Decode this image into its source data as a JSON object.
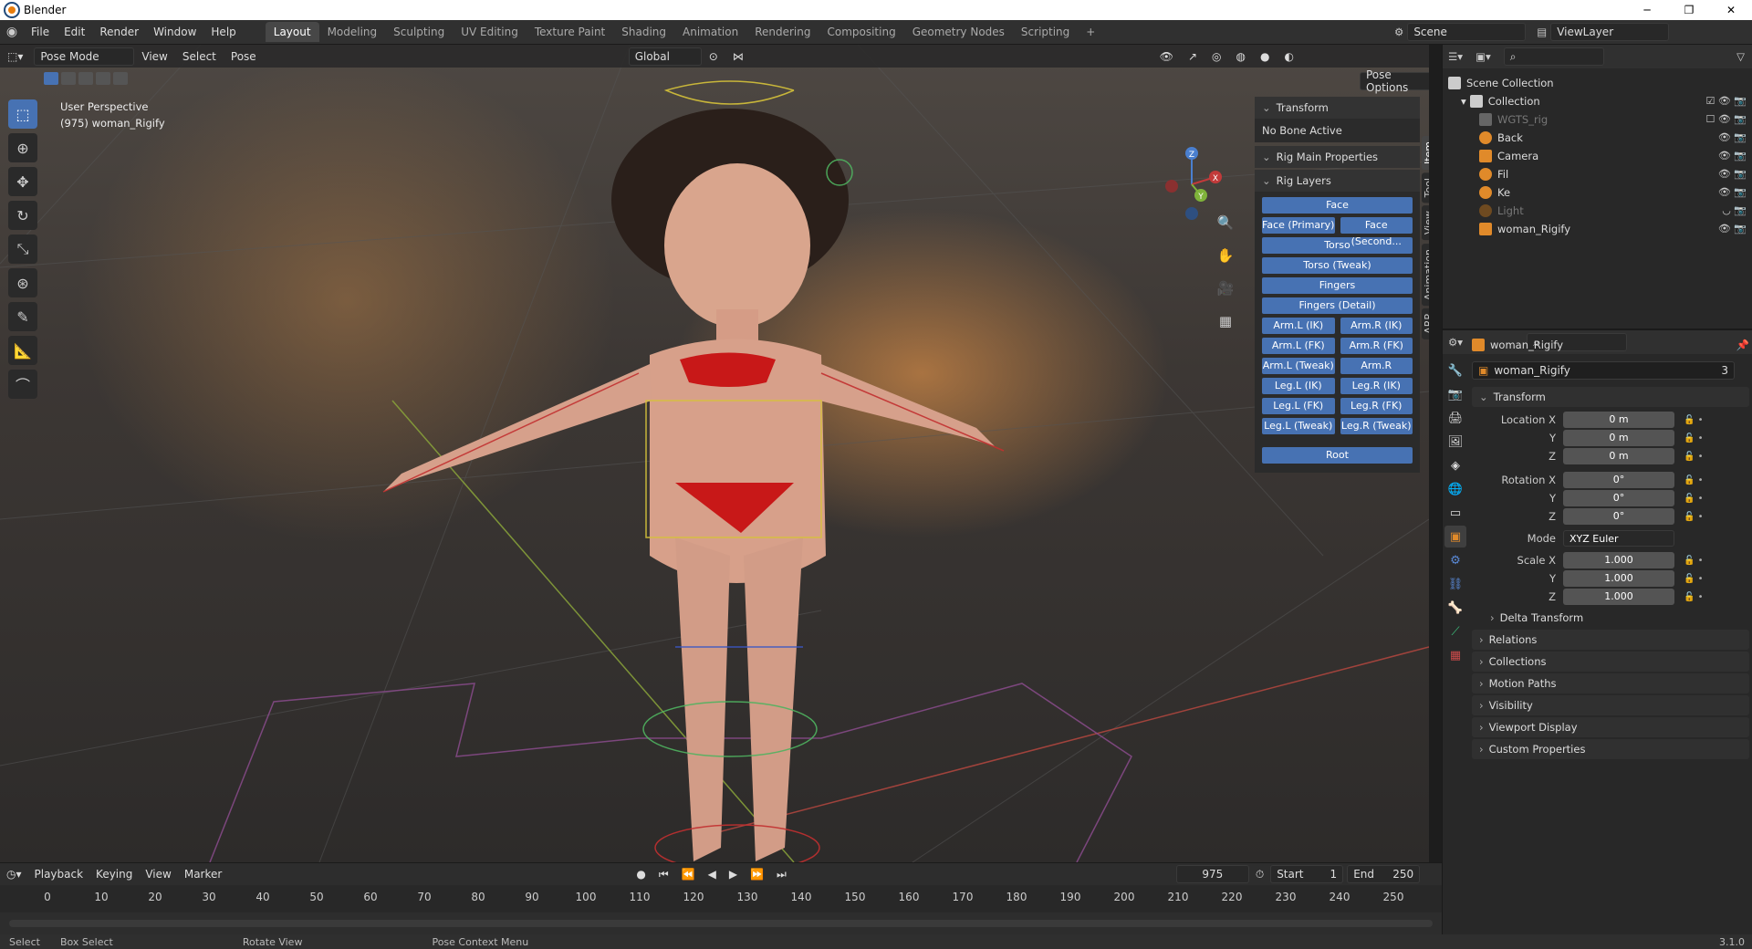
{
  "window": {
    "title": "Blender",
    "minimize": "─",
    "maximize": "❐",
    "close": "✕"
  },
  "menubar": {
    "items": [
      "File",
      "Edit",
      "Render",
      "Window",
      "Help"
    ]
  },
  "workspaces": [
    "Layout",
    "Modeling",
    "Sculpting",
    "UV Editing",
    "Texture Paint",
    "Shading",
    "Animation",
    "Rendering",
    "Compositing",
    "Geometry Nodes",
    "Scripting"
  ],
  "active_workspace": "Layout",
  "add_workspace": "+",
  "scene": {
    "name": "Scene",
    "viewlayer": "ViewLayer"
  },
  "viewport_header": {
    "mode": "Pose Mode",
    "menus": [
      "View",
      "Select",
      "Pose"
    ],
    "orientation": "Global",
    "pose_options": "Pose Options"
  },
  "viewport_overlay": {
    "line1": "User Perspective",
    "line2": "(975) woman_Rigify"
  },
  "npanel": {
    "transform": "Transform",
    "no_bone": "No Bone Active",
    "rig_main": "Rig Main Properties",
    "rig_layers": "Rig Layers",
    "layers": [
      [
        "Face"
      ],
      [
        "Face (Primary)",
        "Face (Second..."
      ],
      [
        "Torso"
      ],
      [
        "Torso (Tweak)"
      ],
      [
        "Fingers"
      ],
      [
        "Fingers (Detail)"
      ],
      [
        "Arm.L (IK)",
        "Arm.R (IK)"
      ],
      [
        "Arm.L (FK)",
        "Arm.R (FK)"
      ],
      [
        "Arm.L (Tweak)",
        "Arm.R (Tweak)"
      ],
      [
        "Leg.L (IK)",
        "Leg.R (IK)"
      ],
      [
        "Leg.L (FK)",
        "Leg.R (FK)"
      ],
      [
        "Leg.L (Tweak)",
        "Leg.R (Tweak)"
      ]
    ],
    "root": "Root",
    "tabs": [
      "Item",
      "Tool",
      "View",
      "Animation",
      "ARP"
    ]
  },
  "gizmo_axes": {
    "x": "X",
    "y": "Y",
    "z": "Z"
  },
  "timeline": {
    "menus": [
      "Playback",
      "Keying",
      "View",
      "Marker"
    ],
    "current_frame": "975",
    "start_label": "Start",
    "start": "1",
    "end_label": "End",
    "end": "250",
    "ticks": [
      "0",
      "10",
      "20",
      "30",
      "40",
      "50",
      "60",
      "70",
      "80",
      "90",
      "100",
      "110",
      "120",
      "130",
      "140",
      "150",
      "160",
      "170",
      "180",
      "190",
      "200",
      "210",
      "220",
      "230",
      "240",
      "250"
    ]
  },
  "statusbar": {
    "items": [
      "Select",
      "Box Select",
      "Rotate View",
      "Pose Context Menu"
    ],
    "version": "3.1.0"
  },
  "outliner": {
    "rows": [
      {
        "name": "Scene Collection",
        "indent": 0
      },
      {
        "name": "Collection",
        "indent": 1
      },
      {
        "name": "WGTS_rig",
        "indent": 2
      },
      {
        "name": "Back",
        "indent": 2
      },
      {
        "name": "Camera",
        "indent": 2
      },
      {
        "name": "Fil",
        "indent": 2
      },
      {
        "name": "Ke",
        "indent": 2
      },
      {
        "name": "Light",
        "indent": 2
      },
      {
        "name": "woman_Rigify",
        "indent": 2
      }
    ]
  },
  "properties": {
    "object_name": "woman_Rigify",
    "data_name": "woman_Rigify",
    "users": "3",
    "transform": "Transform",
    "location_x_label": "Location X",
    "location": [
      "0 m",
      "0 m",
      "0 m"
    ],
    "rotation_x_label": "Rotation X",
    "rotation": [
      "0°",
      "0°",
      "0°"
    ],
    "mode_label": "Mode",
    "mode": "XYZ Euler",
    "scale_x_label": "Scale X",
    "scale": [
      "1.000",
      "1.000",
      "1.000"
    ],
    "axis_y": "Y",
    "axis_z": "Z",
    "delta": "Delta Transform",
    "collapsed": [
      "Relations",
      "Collections",
      "Motion Paths",
      "Visibility",
      "Viewport Display",
      "Custom Properties"
    ]
  },
  "colors": {
    "accent": "#4772b3",
    "viewport_bg": "#3c3734",
    "panel": "#282828"
  }
}
